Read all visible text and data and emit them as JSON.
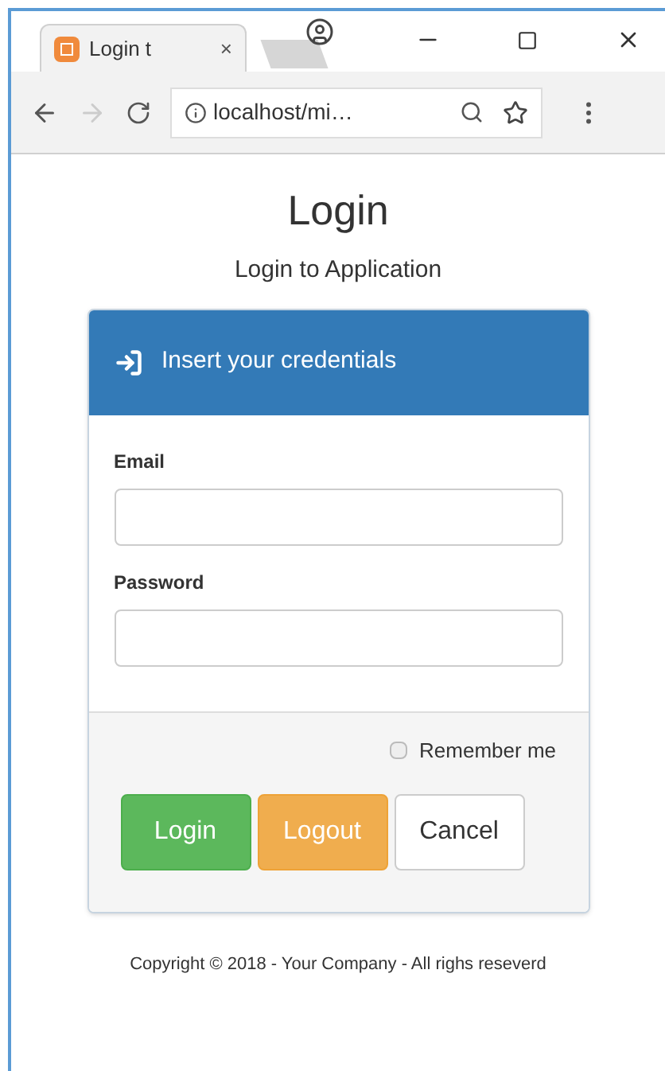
{
  "browser": {
    "tab_title": "Login t",
    "tab_close": "×",
    "address": "localhost/mi…"
  },
  "page": {
    "title": "Login",
    "subtitle": "Login to Application"
  },
  "panel": {
    "heading": "Insert your credentials",
    "fields": [
      {
        "label": "Email"
      },
      {
        "label": "Password"
      }
    ],
    "remember": {
      "label": "Remember me",
      "checked": false
    },
    "buttons": [
      {
        "label": "Login",
        "kind": "success"
      },
      {
        "label": "Logout",
        "kind": "warning"
      },
      {
        "label": "Cancel",
        "kind": "default"
      }
    ]
  },
  "footer": "Copyright © 2018 - Your Company - All righs reseverd"
}
